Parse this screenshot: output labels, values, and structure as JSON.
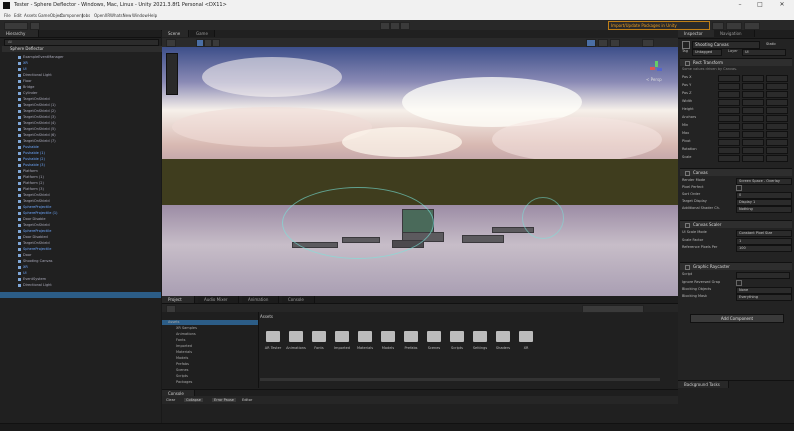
{
  "window": {
    "title": "Tester - Sphere Deflector - Windows, Mac, Linux - Unity 2021.3.8f1 Personal <DX11>",
    "minimize": "–",
    "maximize": "□",
    "close": "✕"
  },
  "menu": [
    "File",
    "Edit",
    "Assets",
    "GameObject",
    "Component",
    "Jobs",
    "OpenXRWhatsNew",
    "Window",
    "Help"
  ],
  "toolbar": {
    "upgrade_notice": "Import/Update Packages in Unity"
  },
  "hierarchy": {
    "tab": "Hierarchy",
    "search_placeholder": "All",
    "scene_name": "Sphere Deflector",
    "rows": [
      {
        "label": "ExampleEventManager",
        "blue": false
      },
      {
        "label": "XR",
        "blue": true
      },
      {
        "label": "UI",
        "blue": true
      },
      {
        "label": "Directional Light",
        "blue": false
      },
      {
        "label": "Floor",
        "blue": false
      },
      {
        "label": "Bridge",
        "blue": false
      },
      {
        "label": "Cylinder",
        "blue": false
      },
      {
        "label": "TargetOnShield",
        "blue": false
      },
      {
        "label": "TargetOnShield (1)",
        "blue": false
      },
      {
        "label": "TargetOnShield (2)",
        "blue": false
      },
      {
        "label": "TargetOnShield (3)",
        "blue": false
      },
      {
        "label": "TargetOnShield (4)",
        "blue": false
      },
      {
        "label": "TargetOnShield (5)",
        "blue": false
      },
      {
        "label": "TargetOnShield (6)",
        "blue": false
      },
      {
        "label": "TargetOnShield (7)",
        "blue": false
      },
      {
        "label": "Pushable",
        "blue": true
      },
      {
        "label": "Pushable (1)",
        "blue": true
      },
      {
        "label": "Pushable (2)",
        "blue": true
      },
      {
        "label": "Pushable (3)",
        "blue": true
      },
      {
        "label": "Platform",
        "blue": false
      },
      {
        "label": "Platform (1)",
        "blue": false
      },
      {
        "label": "Platform (2)",
        "blue": false
      },
      {
        "label": "Platform (3)",
        "blue": false
      },
      {
        "label": "TargetOnShield",
        "blue": false
      },
      {
        "label": "TargetOnShield",
        "blue": false
      },
      {
        "label": "SphereProjectile",
        "blue": true
      },
      {
        "label": "SphereProjectile (1)",
        "blue": true
      },
      {
        "label": "Door Disable",
        "blue": false
      },
      {
        "label": "TargetOnShield",
        "blue": false
      },
      {
        "label": "SphereProjectile",
        "blue": true
      },
      {
        "label": "Door Disabled",
        "blue": false
      },
      {
        "label": "TargetOnShield",
        "blue": false
      },
      {
        "label": "SphereProjectile",
        "blue": true
      },
      {
        "label": "Door",
        "blue": false
      },
      {
        "label": "Shooting Canvas",
        "blue": false
      },
      {
        "label": "XR",
        "blue": true
      },
      {
        "label": "UI",
        "blue": true
      },
      {
        "label": "EventSystem",
        "blue": false
      },
      {
        "label": "Directional Light",
        "blue": false
      }
    ]
  },
  "scene_view": {
    "tabs": [
      "Scene",
      "Game"
    ],
    "persp_label": "< Persp"
  },
  "project": {
    "tabs": [
      "Project",
      "Audio Mixer",
      "Animation",
      "Console"
    ],
    "breadcrumb": "Assets",
    "tree": [
      "Assets",
      "XR Samples",
      "Animations",
      "Fonts",
      "Imported",
      "Materials",
      "Models",
      "Prefabs",
      "Scenes",
      "Scripts",
      "Packages"
    ],
    "folders": [
      "AR Tester",
      "Animations",
      "Fonts",
      "Imported",
      "Materials",
      "Models",
      "Prefabs",
      "Scenes",
      "Scripts",
      "Settings",
      "Shaders",
      "XR"
    ]
  },
  "console": {
    "tab": "Console",
    "buttons": [
      "Clear",
      "Collapse",
      "Error Pause",
      "Editor"
    ]
  },
  "inspector": {
    "tabs": [
      "Inspector",
      "Navigation"
    ],
    "object_name": "Shooting Canvas",
    "static_label": "Static",
    "tag_label": "Tag",
    "tag_value": "Untagged",
    "layer_label": "Layer",
    "layer_value": "UI",
    "rect_transform": "Rect Transform",
    "rect_note": "Some values driven by Canvas.",
    "fields": [
      "Pos X",
      "Pos Y",
      "Pos Z",
      "Width",
      "Height",
      "Anchors",
      "Min",
      "Max",
      "Pivot",
      "Rotation",
      "Scale"
    ],
    "canvas": "Canvas",
    "render_mode_label": "Render Mode",
    "render_mode_value": "Screen Space - Overlay",
    "pixel_perfect_label": "Pixel Perfect",
    "sort_order_label": "Sort Order",
    "sort_order_value": "0",
    "target_display_label": "Target Display",
    "target_display_value": "Display 1",
    "shader_channels_label": "Additional Shader Ch.",
    "shader_channels_value": "Nothing",
    "canvas_scaler": "Canvas Scaler",
    "ui_scale_label": "UI Scale Mode",
    "ui_scale_value": "Constant Pixel Size",
    "scale_factor_label": "Scale Factor",
    "scale_factor_value": "1",
    "ref_pixels_label": "Reference Pixels Per",
    "ref_pixels_value": "100",
    "graphic_raycaster": "Graphic Raycaster",
    "script_label": "Script",
    "ignore_reversed_label": "Ignore Reversed Grap",
    "blocking_objects_label": "Blocking Objects",
    "blocking_objects_value": "None",
    "blocking_mask_label": "Blocking Mask",
    "blocking_mask_value": "Everything",
    "add_component": "Add Component"
  },
  "background_tasks": {
    "label": "Background Tasks"
  }
}
